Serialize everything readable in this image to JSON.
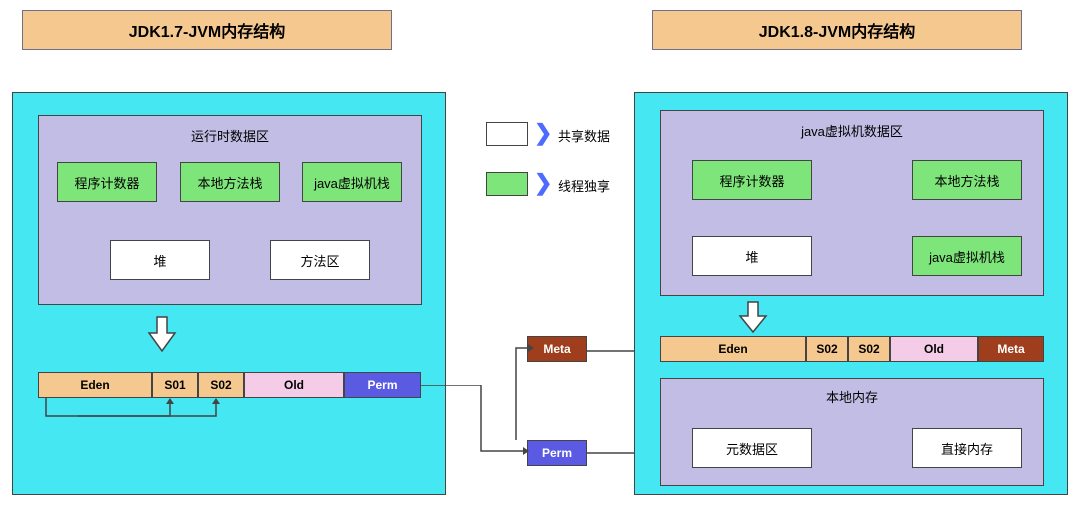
{
  "titles": {
    "left": "JDK1.7-JVM内存结构",
    "right": "JDK1.8-JVM内存结构"
  },
  "legend": {
    "shared": "共享数据",
    "thread": "线程独享"
  },
  "jdk17": {
    "runtime_title": "运行时数据区",
    "pc": "程序计数器",
    "native_stack": "本地方法栈",
    "vm_stack": "java虚拟机栈",
    "heap": "堆",
    "method_area": "方法区",
    "mem": {
      "eden": "Eden",
      "s01": "S01",
      "s02": "S02",
      "old": "Old",
      "perm": "Perm"
    }
  },
  "center": {
    "meta": "Meta",
    "perm": "Perm"
  },
  "jdk18": {
    "runtime_title": "java虚拟机数据区",
    "pc": "程序计数器",
    "native_stack": "本地方法栈",
    "heap": "堆",
    "vm_stack": "java虚拟机栈",
    "mem": {
      "eden": "Eden",
      "s02a": "S02",
      "s02b": "S02",
      "old": "Old",
      "meta": "Meta"
    },
    "local_mem_title": "本地内存",
    "metaspace": "元数据区",
    "direct_mem": "直接内存"
  }
}
